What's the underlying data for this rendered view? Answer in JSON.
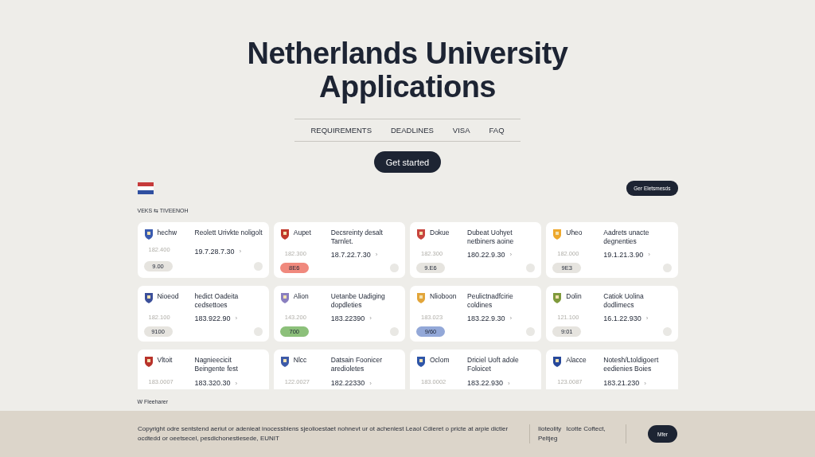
{
  "hero": {
    "title": "Netherlands University Applications",
    "nav": [
      {
        "label": "REQUIREMENTS"
      },
      {
        "label": "DEADLINES"
      },
      {
        "label": "VISA"
      },
      {
        "label": "FAQ"
      }
    ],
    "cta": "Get started"
  },
  "toolbar": {
    "action": "Ger Eletsmesds"
  },
  "section_label": "VEKS ⇆ TIVEENOH",
  "cards": [
    {
      "name": "hechw",
      "title": "Reolett Urivkte noligolt",
      "code": "182.400",
      "date": "19.7.28.7.30",
      "chevron": "›",
      "badge": "9.00",
      "color": "#e6e4df"
    },
    {
      "name": "Aupet",
      "title": "Decsreinty desalt Tarnlet.",
      "code": "182.300",
      "date": "18.7.22.7.30",
      "chevron": "›",
      "badge": "8E6",
      "color": "#f0897d"
    },
    {
      "name": "Dokue",
      "title": "Dubeat Uohyet netbiners aoine",
      "code": "182.300",
      "date": "180.22.9.30",
      "chevron": "›",
      "badge": "9.E6",
      "color": "#e6e4df"
    },
    {
      "name": "Uheo",
      "title": "Aadrets unacte degnenties",
      "code": "182.000",
      "date": "19.1.21.3.90",
      "chevron": "›",
      "badge": "9E3",
      "color": "#e6e4df"
    },
    {
      "name": "Nioeod",
      "title": "hedict Oadeita cedsettoes",
      "code": "182.100",
      "date": "183.922.90",
      "chevron": "›",
      "badge": "9100",
      "color": "#e6e4df"
    },
    {
      "name": "Alion",
      "title": "Uetanbe Uadiging dopdleties",
      "code": "143.200",
      "date": "183.22390",
      "chevron": "›",
      "badge": "700",
      "color": "#8cc07a"
    },
    {
      "name": "Nlioboon",
      "title": "Peulictnadfcirie coldines",
      "code": "183.023",
      "date": "183.22.9.30",
      "chevron": "›",
      "badge": "9/60",
      "color": "#93a8d8"
    },
    {
      "name": "Dolin",
      "title": "Catiok Uolina dodlimecs",
      "code": "121.100",
      "date": "16.1.22.930",
      "chevron": "›",
      "badge": "9:01",
      "color": "#e6e4df"
    },
    {
      "name": "Vltoit",
      "title": "Nagnieecicit Beingente fest",
      "code": "183.0007",
      "date": "183.320.30",
      "chevron": "›"
    },
    {
      "name": "Nlcc",
      "title": "Datsain Foonicer aredioletes",
      "code": "122.0027",
      "date": "182.22330",
      "chevron": "›"
    },
    {
      "name": "Oclom",
      "title": "Driciel Uoft adole Foloicet",
      "code": "183.0002",
      "date": "183.22.930",
      "chevron": "›"
    },
    {
      "name": "Alacce",
      "title": "Notesh/Ltoldigoert eedienies Boies",
      "code": "123.0087",
      "date": "183.21.230",
      "chevron": "›"
    }
  ],
  "more_label": "W Fleeharer",
  "footer": {
    "legal": "Copyright odre sentstend aeriut or adenieat inocessbiens sjeolioestaet nohnevt ur ot achenlest Leaol  Cdieret o pricte at arpie dictier ocdtedd or oeetsecel, pesdichonestiesede, EUNIT",
    "links": [
      {
        "label": "Iioteolity"
      },
      {
        "label": "Icotte Coftect,"
      },
      {
        "label": "Peltjeg"
      }
    ],
    "button": "Mfer"
  }
}
